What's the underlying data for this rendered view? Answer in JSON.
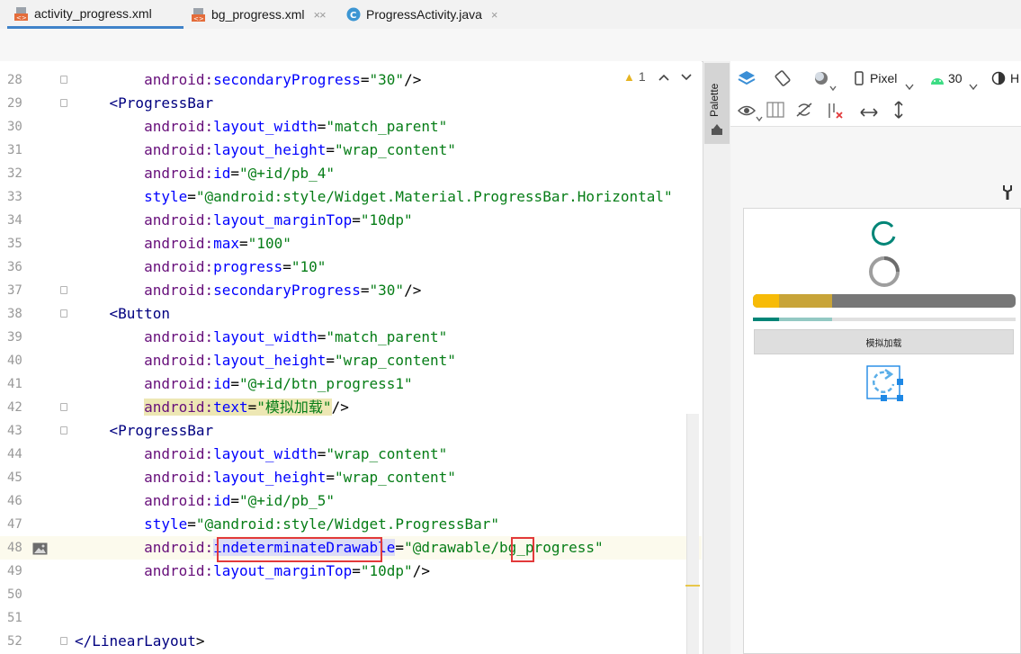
{
  "tabs": [
    {
      "label": "activity_progress.xml",
      "icon": "xml-layout-icon",
      "active": true
    },
    {
      "label": "bg_progress.xml",
      "icon": "xml-drawable-icon",
      "active": false
    },
    {
      "label": "ProgressActivity.java",
      "icon": "java-class-icon",
      "active": false
    }
  ],
  "tab_close_glyph": "×",
  "warning": {
    "glyph": "▲",
    "count": "1"
  },
  "code_lines": [
    {
      "n": "28",
      "segs": [
        [
          "ind",
          "        "
        ],
        [
          "ns",
          "android:"
        ],
        [
          "at",
          "secondaryProgress"
        ],
        [
          "pn",
          "="
        ],
        [
          "vl",
          "\"30\""
        ],
        [
          "pn",
          "/>"
        ]
      ]
    },
    {
      "n": "29",
      "segs": [
        [
          "ind",
          "    "
        ],
        [
          "tag",
          "<ProgressBar"
        ]
      ]
    },
    {
      "n": "30",
      "segs": [
        [
          "ind",
          "        "
        ],
        [
          "ns",
          "android:"
        ],
        [
          "at",
          "layout_width"
        ],
        [
          "pn",
          "="
        ],
        [
          "vl",
          "\"match_parent\""
        ]
      ]
    },
    {
      "n": "31",
      "segs": [
        [
          "ind",
          "        "
        ],
        [
          "ns",
          "android:"
        ],
        [
          "at",
          "layout_height"
        ],
        [
          "pn",
          "="
        ],
        [
          "vl",
          "\"wrap_content\""
        ]
      ]
    },
    {
      "n": "32",
      "segs": [
        [
          "ind",
          "        "
        ],
        [
          "ns",
          "android:"
        ],
        [
          "at",
          "id"
        ],
        [
          "pn",
          "="
        ],
        [
          "vl",
          "\"@+id/pb_4\""
        ]
      ]
    },
    {
      "n": "33",
      "segs": [
        [
          "ind",
          "        "
        ],
        [
          "at",
          "style"
        ],
        [
          "pn",
          "="
        ],
        [
          "vl",
          "\"@android:style/Widget.Material.ProgressBar.Horizontal\""
        ]
      ]
    },
    {
      "n": "34",
      "segs": [
        [
          "ind",
          "        "
        ],
        [
          "ns",
          "android:"
        ],
        [
          "at",
          "layout_marginTop"
        ],
        [
          "pn",
          "="
        ],
        [
          "vl",
          "\"10dp\""
        ]
      ]
    },
    {
      "n": "35",
      "segs": [
        [
          "ind",
          "        "
        ],
        [
          "ns",
          "android:"
        ],
        [
          "at",
          "max"
        ],
        [
          "pn",
          "="
        ],
        [
          "vl",
          "\"100\""
        ]
      ]
    },
    {
      "n": "36",
      "segs": [
        [
          "ind",
          "        "
        ],
        [
          "ns",
          "android:"
        ],
        [
          "at",
          "progress"
        ],
        [
          "pn",
          "="
        ],
        [
          "vl",
          "\"10\""
        ]
      ]
    },
    {
      "n": "37",
      "segs": [
        [
          "ind",
          "        "
        ],
        [
          "ns",
          "android:"
        ],
        [
          "at",
          "secondaryProgress"
        ],
        [
          "pn",
          "="
        ],
        [
          "vl",
          "\"30\""
        ],
        [
          "pn",
          "/>"
        ]
      ]
    },
    {
      "n": "38",
      "segs": [
        [
          "ind",
          "    "
        ],
        [
          "tag",
          "<Button"
        ]
      ]
    },
    {
      "n": "39",
      "segs": [
        [
          "ind",
          "        "
        ],
        [
          "ns",
          "android:"
        ],
        [
          "at",
          "layout_width"
        ],
        [
          "pn",
          "="
        ],
        [
          "vl",
          "\"match_parent\""
        ]
      ]
    },
    {
      "n": "40",
      "segs": [
        [
          "ind",
          "        "
        ],
        [
          "ns",
          "android:"
        ],
        [
          "at",
          "layout_height"
        ],
        [
          "pn",
          "="
        ],
        [
          "vl",
          "\"wrap_content\""
        ]
      ]
    },
    {
      "n": "41",
      "segs": [
        [
          "ind",
          "        "
        ],
        [
          "ns",
          "android:"
        ],
        [
          "at",
          "id"
        ],
        [
          "pn",
          "="
        ],
        [
          "vl",
          "\"@+id/btn_progress1\""
        ]
      ]
    },
    {
      "n": "42",
      "segs": [
        [
          "ind",
          "        "
        ],
        [
          "nsh",
          "android:"
        ],
        [
          "ath",
          "text"
        ],
        [
          "pnh",
          "="
        ],
        [
          "vlh",
          "\"模拟加载\""
        ],
        [
          "pn",
          "/>"
        ]
      ]
    },
    {
      "n": "43",
      "segs": [
        [
          "ind",
          "    "
        ],
        [
          "tag",
          "<ProgressBar"
        ]
      ]
    },
    {
      "n": "44",
      "segs": [
        [
          "ind",
          "        "
        ],
        [
          "ns",
          "android:"
        ],
        [
          "at",
          "layout_width"
        ],
        [
          "pn",
          "="
        ],
        [
          "vl",
          "\"wrap_content\""
        ]
      ]
    },
    {
      "n": "45",
      "segs": [
        [
          "ind",
          "        "
        ],
        [
          "ns",
          "android:"
        ],
        [
          "at",
          "layout_height"
        ],
        [
          "pn",
          "="
        ],
        [
          "vl",
          "\"wrap_content\""
        ]
      ]
    },
    {
      "n": "46",
      "segs": [
        [
          "ind",
          "        "
        ],
        [
          "ns",
          "android:"
        ],
        [
          "at",
          "id"
        ],
        [
          "pn",
          "="
        ],
        [
          "vl",
          "\"@+id/pb_5\""
        ]
      ]
    },
    {
      "n": "47",
      "segs": [
        [
          "ind",
          "        "
        ],
        [
          "at",
          "style"
        ],
        [
          "pn",
          "="
        ],
        [
          "vl",
          "\"@android:style/Widget.ProgressBar\""
        ]
      ]
    },
    {
      "n": "48",
      "segs": [
        [
          "ind",
          "        "
        ],
        [
          "ns",
          "android:"
        ],
        [
          "ats",
          "indeterminateDrawable"
        ],
        [
          "pn",
          "="
        ],
        [
          "vl",
          "\"@drawable/bg_progress\""
        ]
      ]
    },
    {
      "n": "49",
      "segs": [
        [
          "ind",
          "        "
        ],
        [
          "ns",
          "android:"
        ],
        [
          "at",
          "layout_marginTop"
        ],
        [
          "pn",
          "="
        ],
        [
          "vl",
          "\"10dp\""
        ],
        [
          "pn",
          "/>"
        ]
      ]
    },
    {
      "n": "50",
      "segs": []
    },
    {
      "n": "51",
      "segs": []
    },
    {
      "n": "52",
      "segs": [
        [
          "tag",
          "</LinearLayout"
        ],
        [
          "pn",
          ">"
        ]
      ]
    }
  ],
  "palette_label": "Palette",
  "design_toolbar": {
    "device": "Pixel",
    "api": "30",
    "theme_initial": "H"
  },
  "preview": {
    "button_text": "模拟加载",
    "progress_primary": 0.1,
    "progress_secondary": 0.3,
    "thin_progress_primary": 0.1,
    "thin_progress_secondary": 0.3
  },
  "colors": {
    "accent": "#008577",
    "yellow": "#f7bb07",
    "yellow_dark": "#c8a438",
    "bar_track": "#777777",
    "teal_light": "#93c9c3",
    "selection_blue": "#1e88e5",
    "error_red": "#e2393a"
  }
}
